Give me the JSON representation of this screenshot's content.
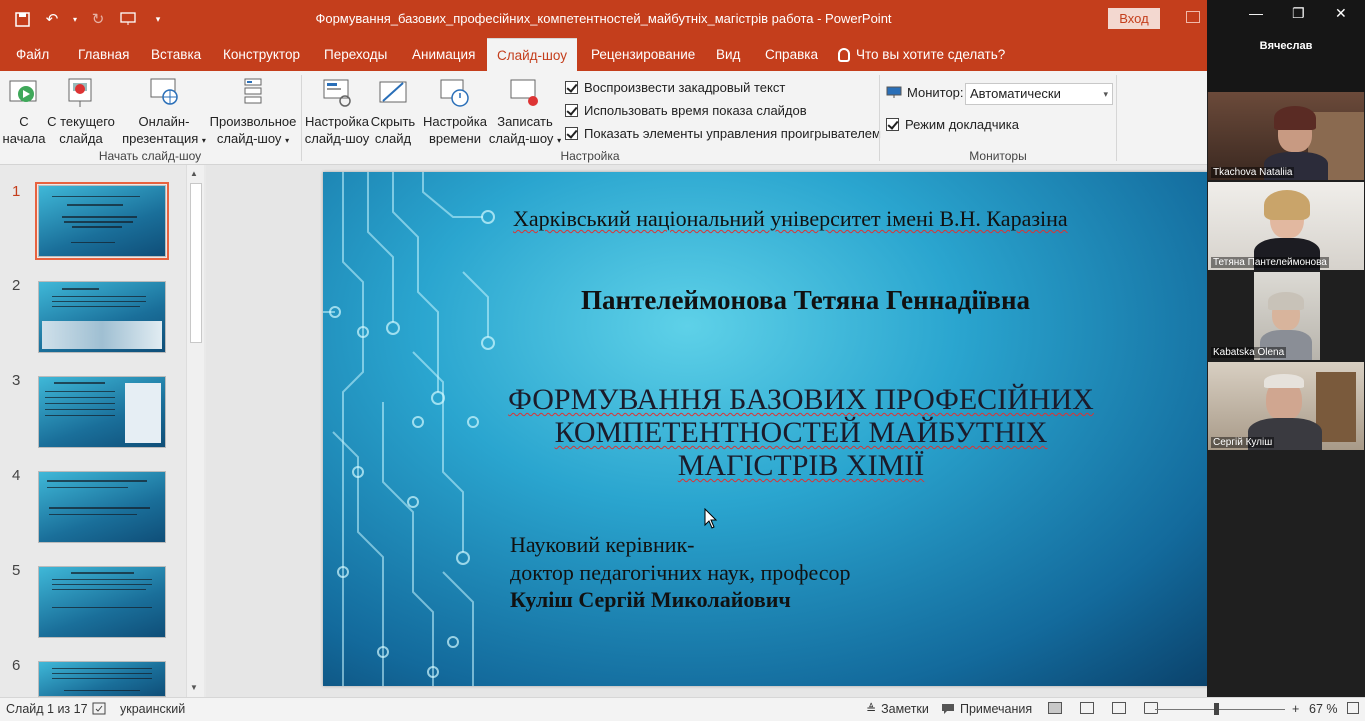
{
  "window": {
    "doc_title": "Формування_базових_професійних_компетентностей_майбутніх_магістрів работа  -  PowerPoint",
    "signin_label": "Вход"
  },
  "tabs": [
    {
      "label": "Файл"
    },
    {
      "label": "Главная"
    },
    {
      "label": "Вставка"
    },
    {
      "label": "Конструктор"
    },
    {
      "label": "Переходы"
    },
    {
      "label": "Анимация"
    },
    {
      "label": "Слайд-шоу",
      "active": true
    },
    {
      "label": "Рецензирование"
    },
    {
      "label": "Вид"
    },
    {
      "label": "Справка"
    }
  ],
  "tell_me": "Что вы хотите сделать?",
  "ribbon": {
    "start_group": {
      "label": "Начать слайд-шоу",
      "from_start": [
        "С",
        "начала"
      ],
      "from_current": [
        "С текущего",
        "слайда"
      ],
      "online": [
        "Онлайн-",
        "презентация"
      ],
      "custom": [
        "Произвольное",
        "слайд-шоу"
      ]
    },
    "setup_group": {
      "label": "Настройка",
      "setup_show": [
        "Настройка",
        "слайд-шоу"
      ],
      "hide_slide": [
        "Скрыть",
        "слайд"
      ],
      "rehearse": [
        "Настройка",
        "времени"
      ],
      "record": [
        "Записать",
        "слайд-шоу"
      ],
      "checks": [
        "Воспроизвести закадровый текст",
        "Использовать время показа слайдов",
        "Показать элементы управления проигрывателем"
      ]
    },
    "monitors_group": {
      "label": "Мониторы",
      "monitor_label": "Монитор:",
      "monitor_value": "Автоматически",
      "presenter_view": "Режим докладчика"
    }
  },
  "thumbnails": [
    {
      "num": "1",
      "active": true
    },
    {
      "num": "2"
    },
    {
      "num": "3"
    },
    {
      "num": "4"
    },
    {
      "num": "5"
    },
    {
      "num": "6"
    }
  ],
  "slide": {
    "university": "Харківський національний університет імені В.Н. Каразіна",
    "author": "Пантелеймонова Тетяна Геннадіївна",
    "topic_lines": [
      "ФОРМУВАННЯ БАЗОВИХ ПРОФЕСІЙНИХ",
      "КОМПЕТЕНТНОСТЕЙ МАЙБУТНІХ",
      "МАГІСТРІВ ХІМІЇ"
    ],
    "supervisor_line1": "Науковий керівник-",
    "supervisor_line2": "доктор педагогічних наук, професор",
    "supervisor_name": "Куліш Сергій Миколайович"
  },
  "status": {
    "slide_info": "Слайд 1 из 17",
    "language": "украинский",
    "notes": "Заметки",
    "comments": "Примечания",
    "zoom": "67 %",
    "zoom_minus": "-",
    "zoom_plus": "+"
  },
  "meeting": {
    "host": "Вячеслав",
    "participants": [
      "Tkachova Nataliia",
      "Тетяна Пантелеймонова",
      "Kabatska Olena",
      "Сергій Куліш"
    ]
  },
  "colors": {
    "accent": "#c43e1c",
    "slide_bg": "#2aa5cf"
  }
}
